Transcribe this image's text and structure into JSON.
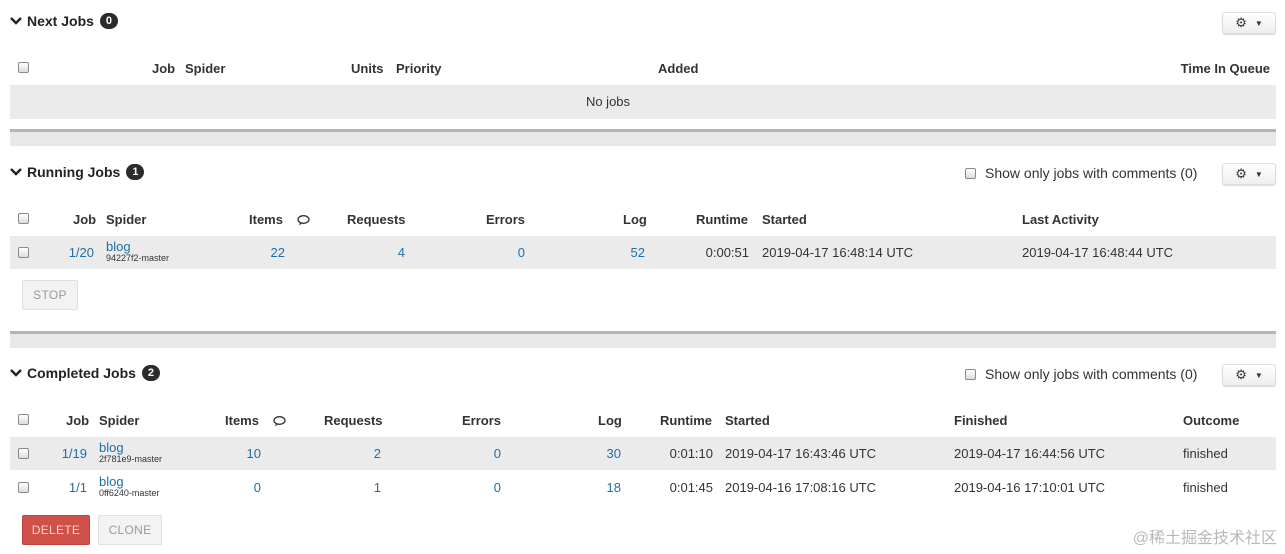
{
  "next_jobs": {
    "title": "Next Jobs",
    "count": "0",
    "columns": {
      "job": "Job",
      "spider": "Spider",
      "units": "Units",
      "priority": "Priority",
      "added": "Added",
      "time_in_queue": "Time In Queue"
    },
    "empty_text": "No jobs"
  },
  "running_jobs": {
    "title": "Running Jobs",
    "count": "1",
    "comments_filter": "Show only jobs with comments (0)",
    "columns": {
      "job": "Job",
      "spider": "Spider",
      "items": "Items",
      "requests": "Requests",
      "errors": "Errors",
      "log": "Log",
      "runtime": "Runtime",
      "started": "Started",
      "last_activity": "Last Activity"
    },
    "rows": [
      {
        "job": "1/20",
        "spider": "blog",
        "version": "94227f2-master",
        "items": "22",
        "requests": "4",
        "errors": "0",
        "log": "52",
        "runtime": "0:00:51",
        "started": "2019-04-17 16:48:14 UTC",
        "last_activity": "2019-04-17 16:48:44 UTC"
      }
    ],
    "stop_label": "STOP"
  },
  "completed_jobs": {
    "title": "Completed Jobs",
    "count": "2",
    "comments_filter": "Show only jobs with comments (0)",
    "columns": {
      "job": "Job",
      "spider": "Spider",
      "items": "Items",
      "requests": "Requests",
      "errors": "Errors",
      "log": "Log",
      "runtime": "Runtime",
      "started": "Started",
      "finished": "Finished",
      "outcome": "Outcome"
    },
    "rows": [
      {
        "job": "1/19",
        "spider": "blog",
        "version": "2f781e9-master",
        "items": "10",
        "requests": "2",
        "errors": "0",
        "log": "30",
        "runtime": "0:01:10",
        "started": "2019-04-17 16:43:46 UTC",
        "finished": "2019-04-17 16:44:56 UTC",
        "outcome": "finished"
      },
      {
        "job": "1/1",
        "spider": "blog",
        "version": "0ff6240-master",
        "items": "0",
        "requests": "1",
        "errors": "0",
        "log": "18",
        "runtime": "0:01:45",
        "started": "2019-04-16 17:08:16 UTC",
        "finished": "2019-04-16 17:10:01 UTC",
        "outcome": "finished"
      }
    ],
    "delete_label": "DELETE",
    "clone_label": "CLONE"
  },
  "watermark": "@稀土掘金技术社区",
  "colors": {
    "link": "#1e6fa8",
    "row_shade": "#ebebeb",
    "badge": "#2b2b2b",
    "danger": "#d0504a"
  }
}
